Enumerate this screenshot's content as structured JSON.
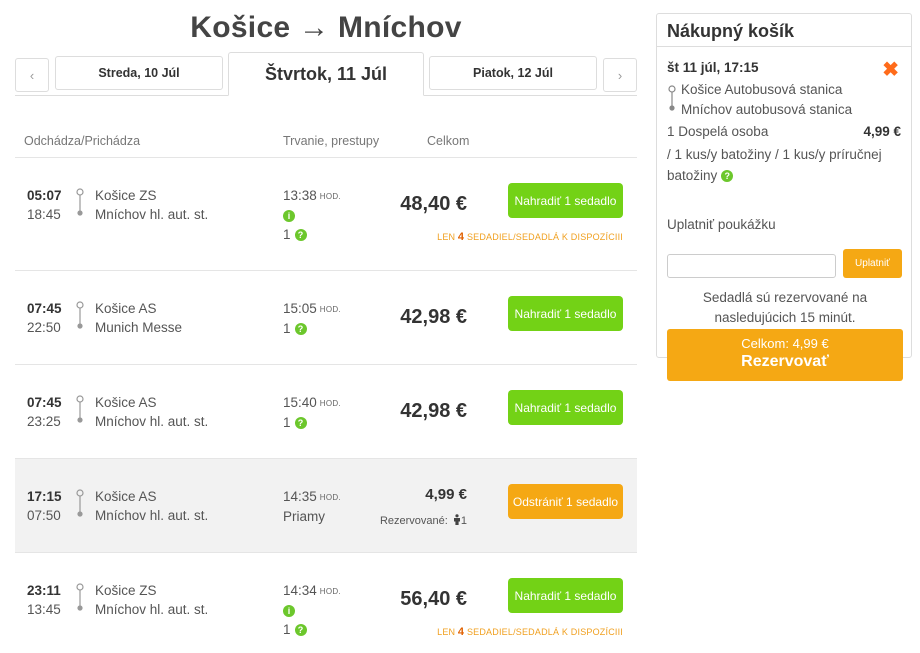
{
  "route": {
    "title": "Košice → Mníchov"
  },
  "date_nav": {
    "prev_arrow": "‹",
    "next_arrow": "›",
    "prev_day": "Streda, 10 Júl",
    "current_day": "Štvrtok, 11 Júl",
    "next_day": "Piatok, 12 Júl"
  },
  "list_header": {
    "departs_arrives": "Odchádza/Prichádza",
    "duration_transfers": "Trvanie, prestupy",
    "total": "Celkom"
  },
  "duration_unit": "HOD.",
  "seats_left_prefix": "LEN",
  "seats_left_suffix": "SEDADIEL/SEDADLÁ K DISPOZÍCIII",
  "connections": [
    {
      "dep": "05:07",
      "arr": "18:45",
      "from": "Košice ZS",
      "to": "Mníchov hl. aut. st.",
      "duration": "13:38",
      "transfers": "1",
      "price": "48,40 €",
      "button": "Nahradiť 1 sedadlo",
      "seats_left": "4"
    },
    {
      "dep": "07:45",
      "arr": "22:50",
      "from": "Košice AS",
      "to": "Munich Messe",
      "duration": "15:05",
      "transfers": "1",
      "price": "42,98 €",
      "button": "Nahradiť 1 sedadlo"
    },
    {
      "dep": "07:45",
      "arr": "23:25",
      "from": "Košice AS",
      "to": "Mníchov hl. aut. st.",
      "duration": "15:40",
      "transfers": "1",
      "price": "42,98 €",
      "button": "Nahradiť 1 sedadlo"
    },
    {
      "dep": "17:15",
      "arr": "07:50",
      "from": "Košice AS",
      "to": "Mníchov hl. aut. st.",
      "duration": "14:35",
      "transfers": "Priamy",
      "price": "4,99 €",
      "button": "Odstrániť 1 sedadlo",
      "reserved_label": "Rezervované:",
      "reserved_count": "1"
    },
    {
      "dep": "23:11",
      "arr": "13:45",
      "from": "Košice ZS",
      "to": "Mníchov hl. aut. st.",
      "duration": "14:34",
      "transfers": "1",
      "price": "56,40 €",
      "button": "Nahradiť 1 sedadlo",
      "seats_left": "4"
    }
  ],
  "cart": {
    "title": "Nákupný košík",
    "trip_date": "št 11 júl, 17:15",
    "from": "Košice Autobusová stanica",
    "to": "Mníchov autobusová stanica",
    "passenger": "1 Dospelá osoba",
    "price": "4,99 €",
    "baggage": "/ 1 kus/y batožiny / 1 kus/y príručnej batožiny",
    "voucher_label": "Uplatniť poukážku",
    "voucher_placeholder": "",
    "voucher_button": "Uplatniť",
    "note": "Sedadlá sú rezervované na nasledujúcich 15 minút.",
    "total": "Celkom: 4,99 €",
    "book_button": "Rezervovať"
  },
  "colors": {
    "green": "#73d216",
    "orange": "#f5a814",
    "remove": "#ff6b1a",
    "info": "#6cc72c"
  }
}
